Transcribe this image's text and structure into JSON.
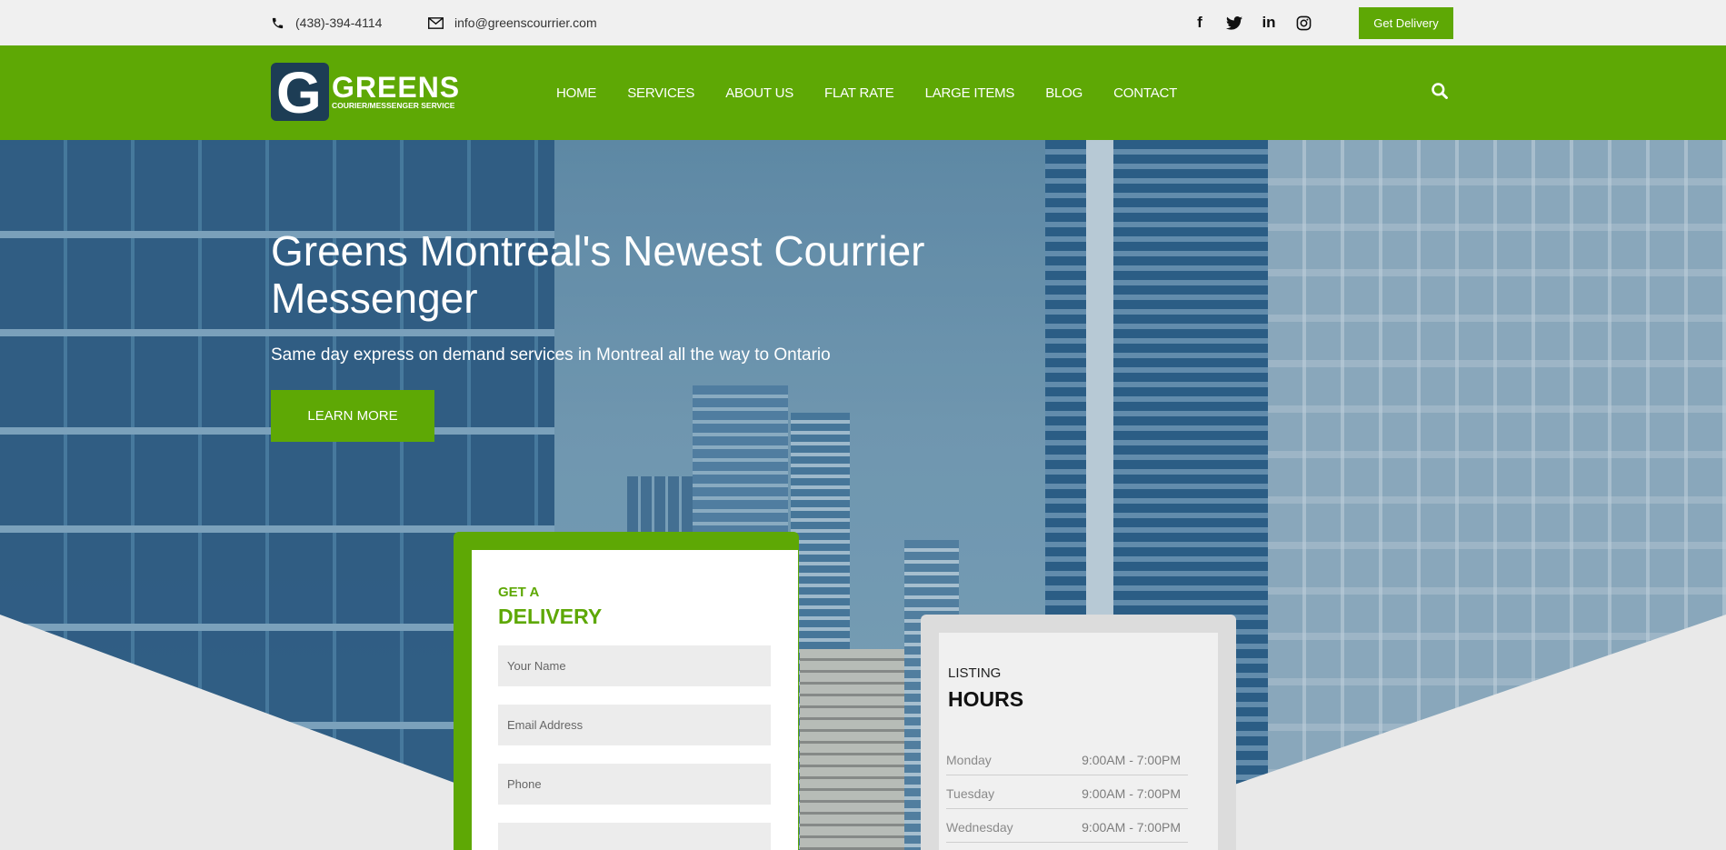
{
  "topbar": {
    "phone": "(438)-394-4114",
    "email": "info@greenscourrier.com",
    "social": [
      "facebook-icon",
      "twitter-icon",
      "linkedin-icon",
      "instagram-icon"
    ],
    "cta": "Get Delivery"
  },
  "logo": {
    "letter": "G",
    "name": "GREENS",
    "tagline": "COURIER/MESSENGER SERVICE"
  },
  "nav": {
    "items": [
      "HOME",
      "SERVICES",
      "ABOUT US",
      "FLAT RATE",
      "LARGE ITEMS",
      "BLOG",
      "CONTACT"
    ]
  },
  "hero": {
    "title": "Greens Montreal's Newest Courrier Messenger",
    "subtitle": "Same day express on demand services in Montreal all the way to Ontario",
    "button": "LEARN MORE"
  },
  "delivery_form": {
    "pre": "GET A",
    "heading": "DELIVERY",
    "placeholders": {
      "name": "Your Name",
      "email": "Email Address",
      "phone": "Phone"
    }
  },
  "hours": {
    "pre": "LISTING",
    "heading": "HOURS",
    "rows": [
      {
        "day": "Monday",
        "time": "9:00AM - 7:00PM"
      },
      {
        "day": "Tuesday",
        "time": "9:00AM - 7:00PM"
      },
      {
        "day": "Wednesday",
        "time": "9:00AM - 7:00PM"
      }
    ]
  },
  "colors": {
    "brand_green": "#5ea805",
    "logo_navy": "#1d3d55",
    "topbar_bg": "#f0f0f0"
  }
}
